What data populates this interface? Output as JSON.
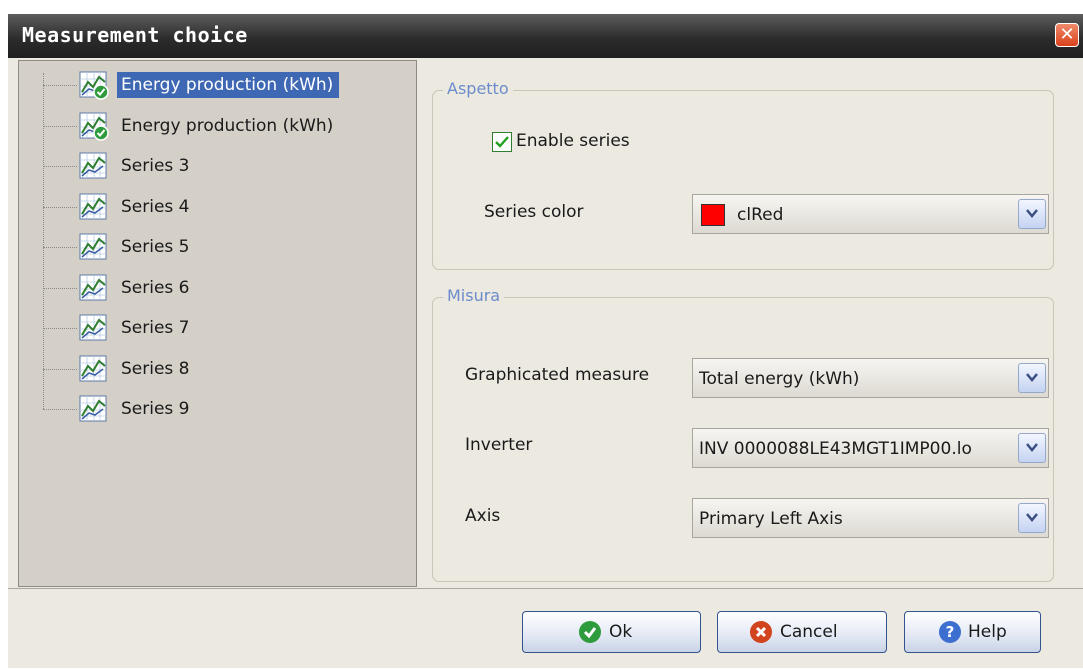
{
  "window": {
    "title": "Measurement choice",
    "close_icon": "close-icon"
  },
  "tree": {
    "items": [
      {
        "label": "Energy production (kWh)",
        "selected": true,
        "checked": true
      },
      {
        "label": "Energy production (kWh)",
        "selected": false,
        "checked": true
      },
      {
        "label": "Series 3",
        "selected": false,
        "checked": false
      },
      {
        "label": "Series 4",
        "selected": false,
        "checked": false
      },
      {
        "label": "Series 5",
        "selected": false,
        "checked": false
      },
      {
        "label": "Series 6",
        "selected": false,
        "checked": false
      },
      {
        "label": "Series 7",
        "selected": false,
        "checked": false
      },
      {
        "label": "Series 8",
        "selected": false,
        "checked": false
      },
      {
        "label": "Series 9",
        "selected": false,
        "checked": false
      }
    ]
  },
  "aspetto": {
    "legend": "Aspetto",
    "enable_series_label": "Enable series",
    "enable_series_checked": true,
    "series_color_label": "Series color",
    "series_color_value": "clRed",
    "series_color_hex": "#ff0000"
  },
  "misura": {
    "legend": "Misura",
    "measure_label": "Graphicated measure",
    "measure_value": "Total energy (kWh)",
    "inverter_label": "Inverter",
    "inverter_value": "INV 0000088LE43MGT1IMP00.lo",
    "axis_label": "Axis",
    "axis_value": "Primary Left Axis"
  },
  "buttons": {
    "ok_label": "Ok",
    "cancel_label": "Cancel",
    "help_label": "Help"
  },
  "colors": {
    "title_bar": "#2c2c2c",
    "selection": "#3e68b4",
    "group_legend": "#6b8ccc",
    "ok_icon": "#2e9b3c",
    "cancel_icon": "#d2441e",
    "help_icon": "#3d6fd1"
  }
}
